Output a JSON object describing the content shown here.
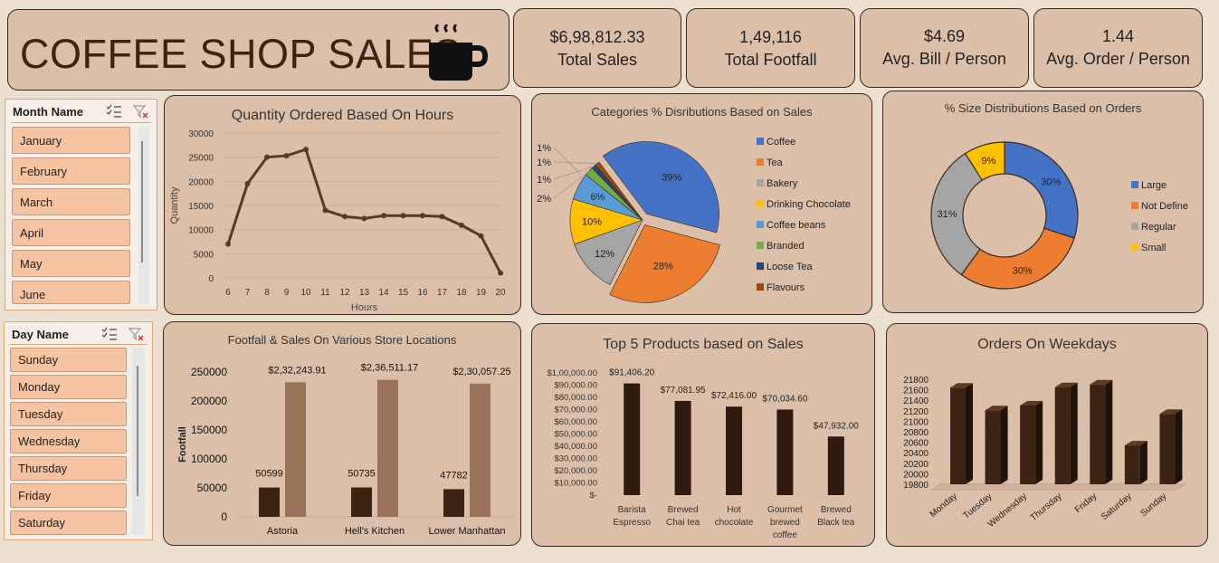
{
  "header": {
    "title": "COFFEE SHOP SALES",
    "icon": "coffee-mug-icon"
  },
  "kpis": [
    {
      "value": "$6,98,812.33",
      "label": "Total Sales"
    },
    {
      "value": "1,49,116",
      "label": "Total Footfall"
    },
    {
      "value": "$4.69",
      "label": "Avg. Bill / Person"
    },
    {
      "value": "1.44",
      "label": "Avg. Order / Person"
    }
  ],
  "month_slicer": {
    "title": "Month Name",
    "items": [
      "January",
      "February",
      "March",
      "April",
      "May",
      "June"
    ]
  },
  "day_slicer": {
    "title": "Day Name",
    "items": [
      "Sunday",
      "Monday",
      "Tuesday",
      "Wednesday",
      "Thursday",
      "Friday",
      "Saturday"
    ]
  },
  "chart_data": [
    {
      "id": "hours",
      "type": "line",
      "title": "Quantity Ordered Based On Hours",
      "xlabel": "Hours",
      "ylabel": "Quantity",
      "x": [
        6,
        7,
        8,
        9,
        10,
        11,
        12,
        13,
        14,
        15,
        16,
        17,
        18,
        19,
        20
      ],
      "values": [
        7000,
        19500,
        25000,
        25300,
        26600,
        14000,
        12700,
        12300,
        12900,
        12900,
        12900,
        12700,
        10900,
        8700,
        1000
      ],
      "yticks": [
        "0",
        "5000",
        "10000",
        "15000",
        "20000",
        "25000",
        "30000"
      ],
      "ylim": [
        0,
        30000
      ],
      "color": "#5a3a22"
    },
    {
      "id": "categories",
      "type": "pie",
      "title": "Categories % Disributions Based on Sales",
      "categories": [
        "Coffee",
        "Tea",
        "Bakery",
        "Drinking Chocolate",
        "Coffee beans",
        "Branded",
        "Loose Tea",
        "Flavours"
      ],
      "values": [
        39,
        28,
        12,
        10,
        6,
        2,
        1,
        1
      ],
      "labels": [
        "39%",
        "28%",
        "12%",
        "10%",
        "6%",
        "2%",
        "1%",
        "1%"
      ],
      "extra_label": "1%",
      "colors": [
        "#4472c4",
        "#ed7d31",
        "#a5a5a5",
        "#ffc000",
        "#5b9bd5",
        "#70ad47",
        "#264478",
        "#9e480e"
      ],
      "legend": "right"
    },
    {
      "id": "sizes",
      "type": "pie",
      "title": "% Size Distributions Based on Orders",
      "categories": [
        "Large",
        "Not Define",
        "Regular",
        "Small"
      ],
      "values": [
        30,
        30,
        31,
        9
      ],
      "labels": [
        "30%",
        "30%",
        "31%",
        "9%"
      ],
      "colors": [
        "#4472c4",
        "#ed7d31",
        "#a5a5a5",
        "#ffc000"
      ],
      "legend": "right"
    },
    {
      "id": "stores",
      "type": "bar",
      "title": "Footfall & Sales On Various Store Locations",
      "categories": [
        "Astoria",
        "Hell's Kitchen",
        "Lower Manhattan"
      ],
      "ylabel": "Footfall",
      "series": [
        {
          "values": [
            50599,
            50735,
            47782
          ],
          "labels": [
            "50599",
            "50735",
            "47782"
          ],
          "color": "#3b2414"
        },
        {
          "values": [
            232243.91,
            236511.17,
            230057.25
          ],
          "labels": [
            "$2,32,243.91",
            "$2,36,511.17",
            "$2,30,057.25"
          ],
          "color": "#9a7258"
        }
      ],
      "yticks": [
        "0",
        "50000",
        "100000",
        "150000",
        "200000",
        "250000"
      ],
      "ylim": [
        0,
        250000
      ]
    },
    {
      "id": "products",
      "type": "bar",
      "title": "Top 5 Products based on Sales",
      "categories": [
        [
          "Barista",
          "Espresso"
        ],
        [
          "Brewed",
          "Chai tea"
        ],
        [
          "Hot",
          "chocolate"
        ],
        [
          "Gourmet",
          "brewed",
          "coffee"
        ],
        [
          "Brewed",
          "Black tea"
        ]
      ],
      "values": [
        91406.2,
        77081.95,
        72416.0,
        70034.6,
        47932.0
      ],
      "labels": [
        "$91,406.20",
        "$77,081.95",
        "$72,416.00",
        "$70,034.60",
        "$47,932.00"
      ],
      "yticks": [
        "$-",
        "$10,000.00",
        "$20,000.00",
        "$30,000.00",
        "$40,000.00",
        "$50,000.00",
        "$60,000.00",
        "$70,000.00",
        "$80,000.00",
        "$90,000.00",
        "$1,00,000.00"
      ],
      "ylim": [
        0,
        100000
      ],
      "color": "#2e1a0e"
    },
    {
      "id": "weekdays",
      "type": "bar",
      "title": "Orders On Weekdays",
      "categories": [
        "Monday",
        "Tuesday",
        "Wednesday",
        "Thursday",
        "Friday",
        "Saturday",
        "Sunday"
      ],
      "values": [
        21640,
        21210,
        21300,
        21650,
        21700,
        20540,
        21140
      ],
      "yticks": [
        "19800",
        "20000",
        "20200",
        "20400",
        "20600",
        "20800",
        "21000",
        "21200",
        "21400",
        "21600",
        "21800"
      ],
      "ylim": [
        19800,
        21800
      ],
      "color": "#3b2414"
    }
  ]
}
